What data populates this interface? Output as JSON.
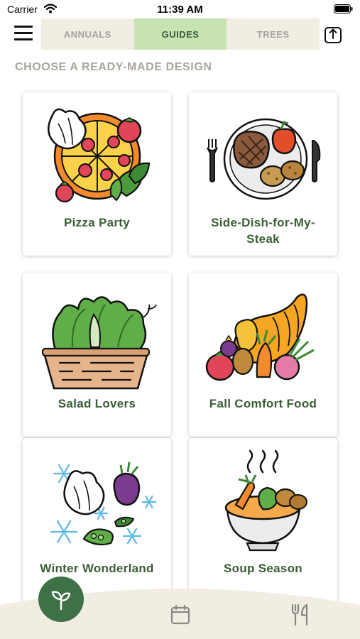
{
  "status_bar": {
    "carrier": "Carrier",
    "time": "11:39 AM",
    "icons": [
      "wifi-icon",
      "battery-icon"
    ]
  },
  "header": {
    "menu_icon": "hamburger-menu-icon",
    "tabs": [
      {
        "label": "ANNUALS",
        "active": false
      },
      {
        "label": "GUIDES",
        "active": true
      },
      {
        "label": "TREES",
        "active": false
      }
    ],
    "share_icon": "share-upload-icon"
  },
  "section_title": "CHOOSE A READY-MADE DESIGN",
  "cards": [
    {
      "label": "Pizza Party",
      "icon": "pizza-illustration"
    },
    {
      "label": "Side-Dish-for-My-Steak",
      "icon": "steak-plate-illustration"
    },
    {
      "label": "Salad Lovers",
      "icon": "salad-basket-illustration"
    },
    {
      "label": "Fall Comfort Food",
      "icon": "cornucopia-illustration"
    },
    {
      "label": "Winter Wonderland",
      "icon": "winter-vegetables-illustration"
    },
    {
      "label": "Soup Season",
      "icon": "soup-bowl-illustration"
    }
  ],
  "bottom_nav": {
    "items": [
      "plant-sprout-icon",
      "calendar-icon",
      "fork-knife-icon"
    ],
    "active": "plant-sprout-icon"
  },
  "colors": {
    "accent_green": "#3f7147",
    "tab_active_bg": "#c7e3b0",
    "tab_bar_bg": "#f1ede3",
    "card_label": "#3a5d35",
    "section_title": "#a9a59d",
    "bottom_bar_bg": "#f1ede3"
  }
}
